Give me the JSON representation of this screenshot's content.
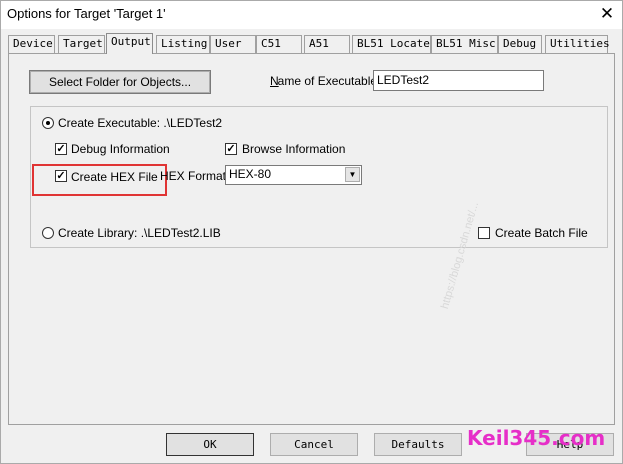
{
  "window": {
    "title": "Options for Target 'Target 1'",
    "close_symbol": "✕"
  },
  "tabs": [
    {
      "label": "Device"
    },
    {
      "label": "Target"
    },
    {
      "label": "Output"
    },
    {
      "label": "Listing"
    },
    {
      "label": "User"
    },
    {
      "label": "C51"
    },
    {
      "label": "A51"
    },
    {
      "label": "BL51 Locate"
    },
    {
      "label": "BL51 Misc"
    },
    {
      "label": "Debug"
    },
    {
      "label": "Utilities"
    }
  ],
  "output": {
    "select_folder_button": "Select Folder for Objects...",
    "name_of_executable_label": "Name of Executable:",
    "name_of_executable_value": "LEDTest2",
    "create_executable_label": "Create Executable:  .\\LEDTest2",
    "create_executable_selected": true,
    "debug_information_label": "Debug Information",
    "debug_information_checked": true,
    "browse_information_label": "Browse Information",
    "browse_information_checked": true,
    "create_hex_label": "Create HEX File",
    "create_hex_checked": true,
    "hex_format_label": "HEX Format:",
    "hex_format_value": "HEX-80",
    "create_library_label": "Create Library:  .\\LEDTest2.LIB",
    "create_library_selected": false,
    "create_batch_label": "Create Batch File",
    "create_batch_checked": false
  },
  "buttons": {
    "ok": "OK",
    "cancel": "Cancel",
    "defaults": "Defaults",
    "help": "Help"
  },
  "watermark": {
    "brand": "Keil345.com",
    "faint_url": "https://blog.csdn.net/..."
  },
  "colors": {
    "highlight_box": "#e03434",
    "watermark": "#e62ec8"
  }
}
